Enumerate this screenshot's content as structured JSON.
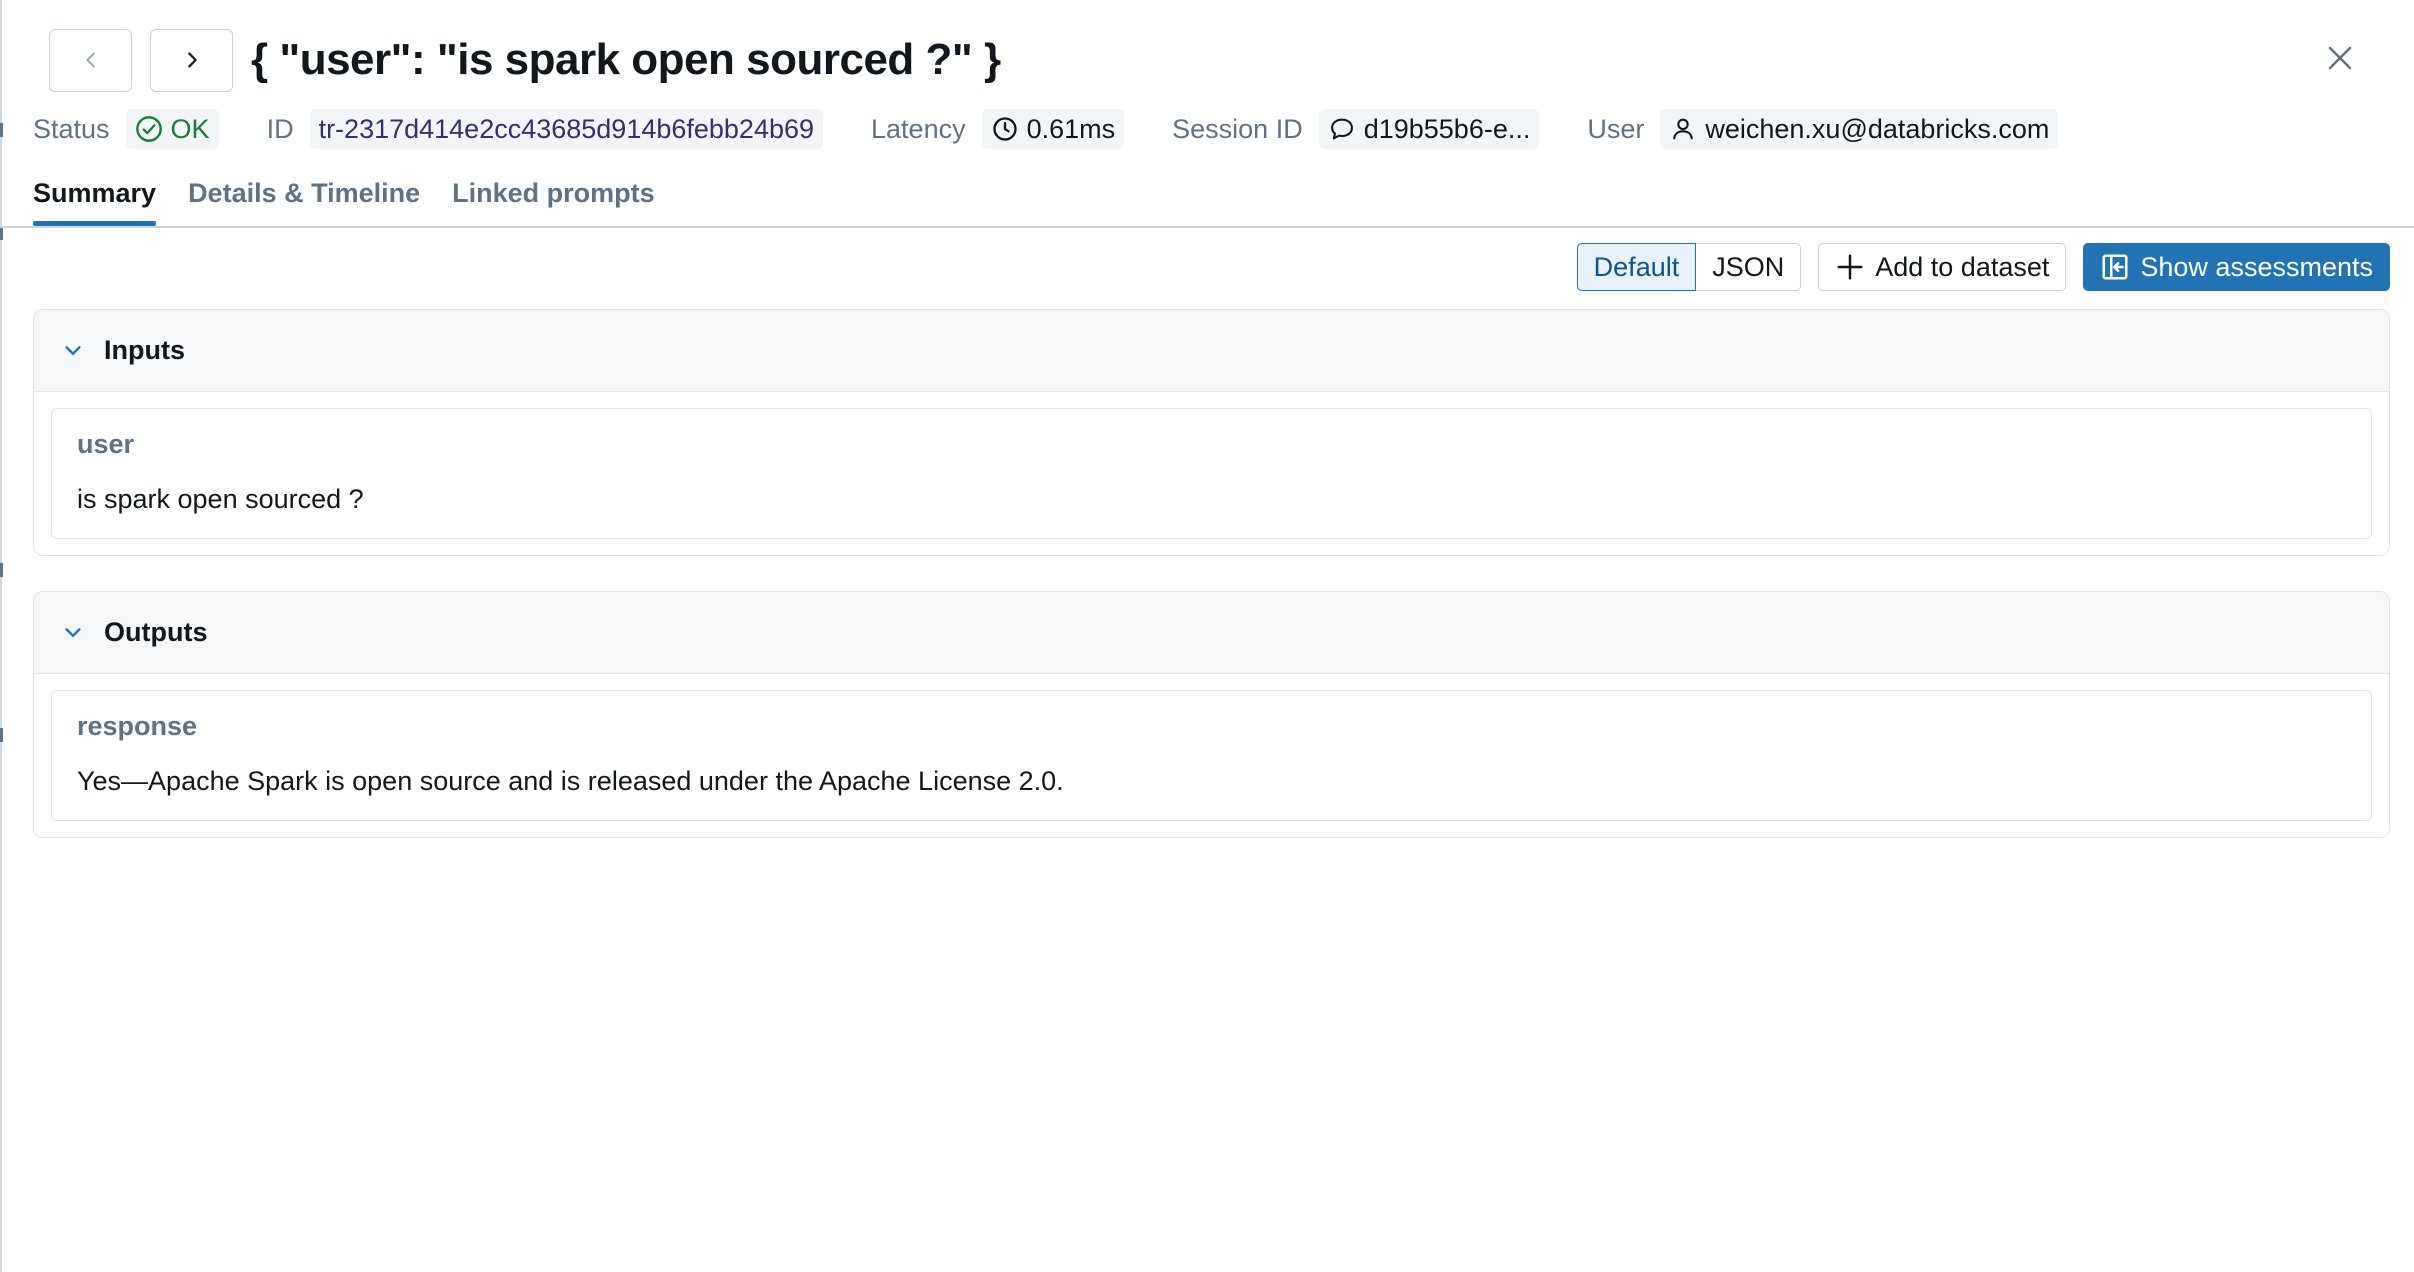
{
  "header": {
    "prev_icon": "chevron-left-icon",
    "next_icon": "chevron-right-icon",
    "title": "{ \"user\": \"is spark open sourced ?\" }",
    "close_icon": "close-icon"
  },
  "meta": {
    "status_label": "Status",
    "status_value": "OK",
    "status_icon": "check-circle-icon",
    "id_label": "ID",
    "id_value": "tr-2317d414e2cc43685d914b6febb24b69",
    "latency_label": "Latency",
    "latency_value": "0.61ms",
    "latency_icon": "clock-icon",
    "session_label": "Session ID",
    "session_value": "d19b55b6-e...",
    "session_icon": "speech-bubble-icon",
    "user_label": "User",
    "user_value": "weichen.xu@databricks.com",
    "user_icon": "user-icon"
  },
  "tabs": [
    {
      "label": "Summary",
      "active": true
    },
    {
      "label": "Details & Timeline",
      "active": false
    },
    {
      "label": "Linked prompts",
      "active": false
    }
  ],
  "toolbar": {
    "view_default": "Default",
    "view_json": "JSON",
    "add_to_dataset": "Add to dataset",
    "show_assessments": "Show assessments"
  },
  "inputs": {
    "title": "Inputs",
    "key": "user",
    "value": "is spark open sourced ?"
  },
  "outputs": {
    "title": "Outputs",
    "key": "response",
    "value": "Yes—Apache Spark is open source and is released under the Apache License 2.0."
  },
  "colors": {
    "accent": "#2272b4",
    "ok_green": "#1a7a3a",
    "muted_text": "#5f7281"
  }
}
